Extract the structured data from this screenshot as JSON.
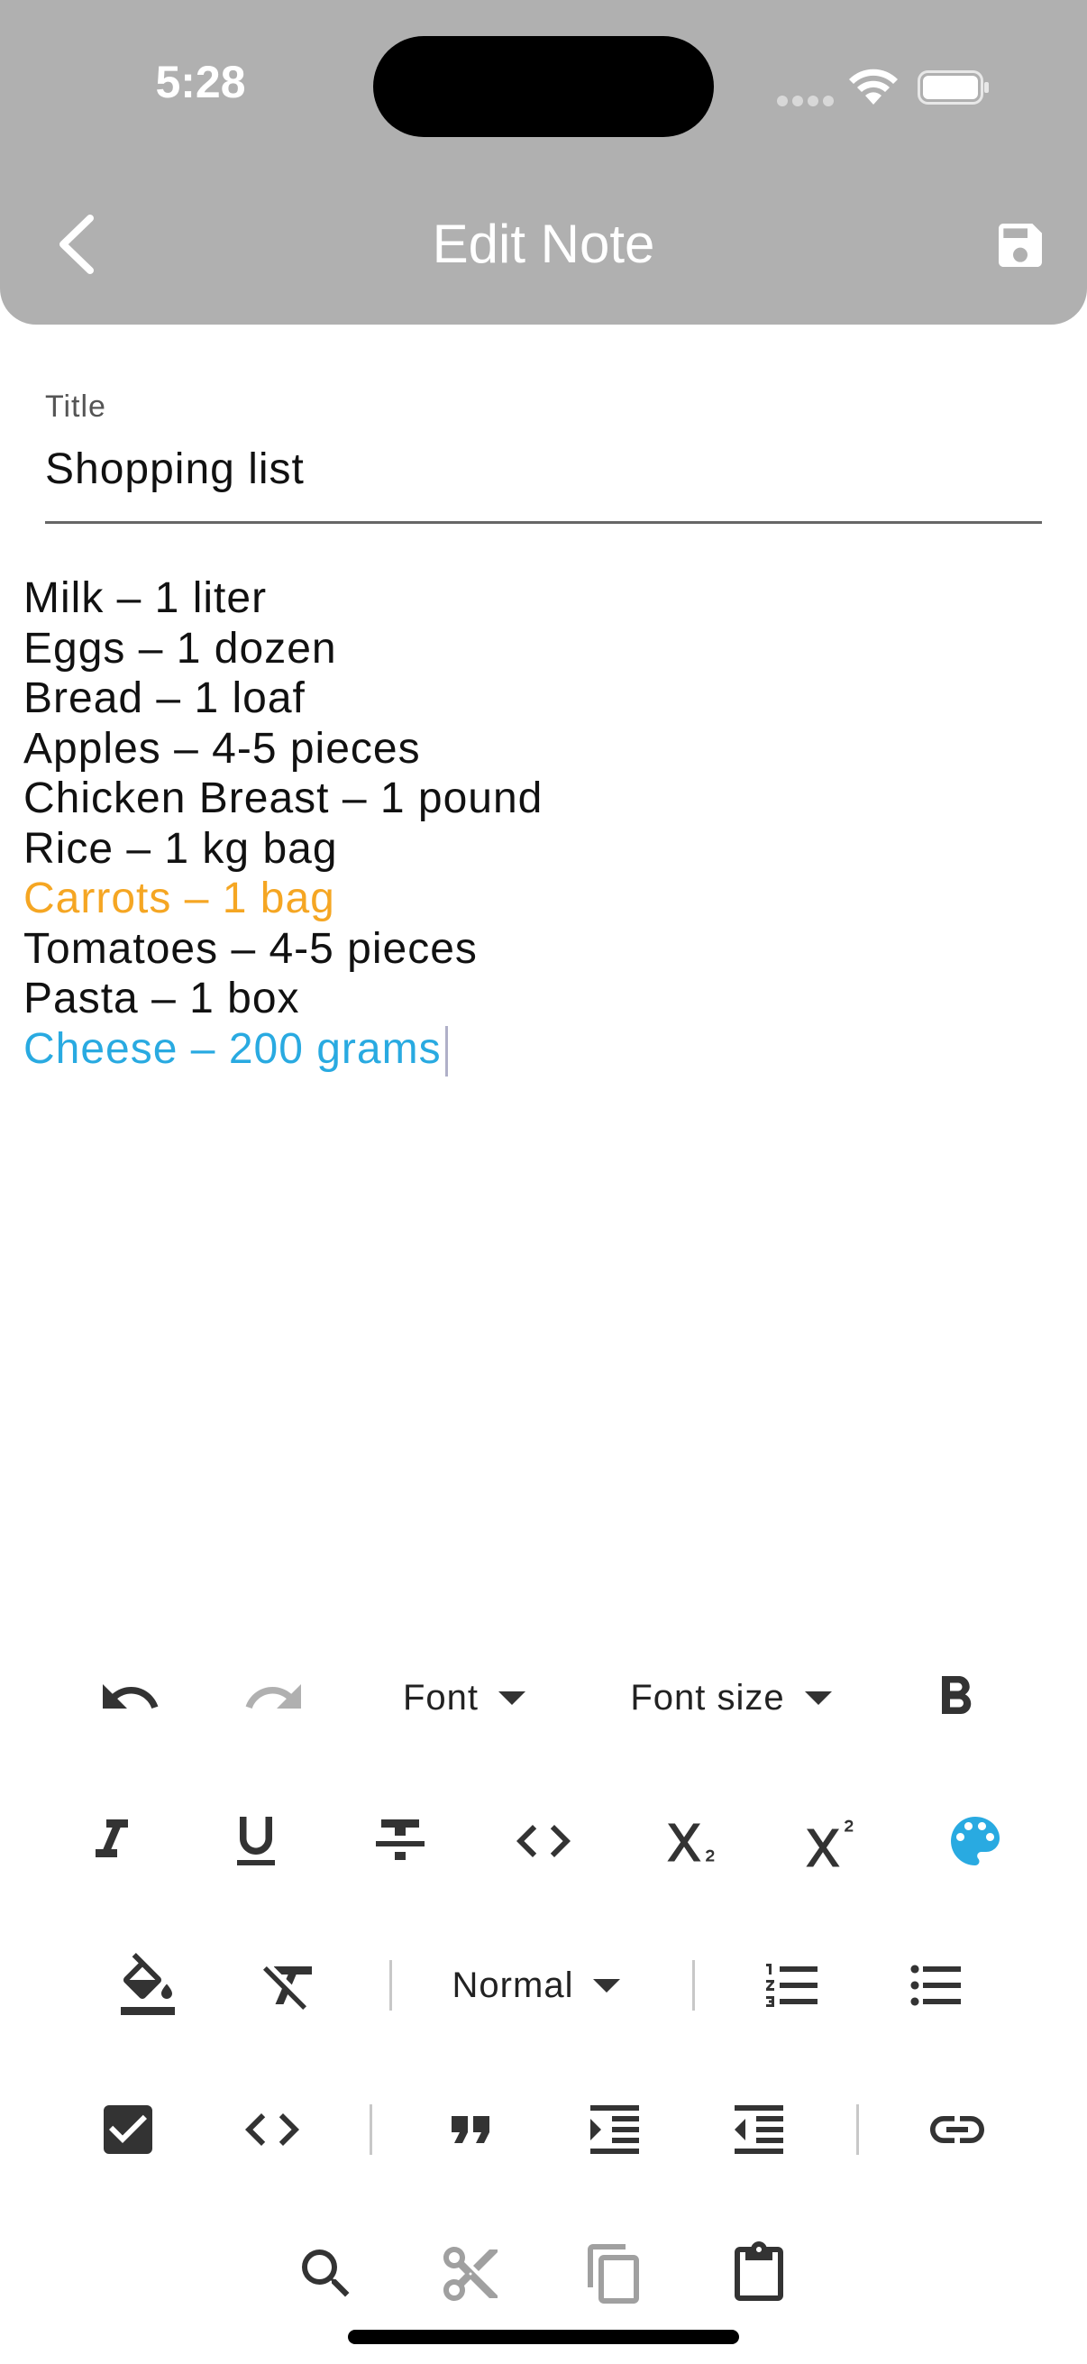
{
  "status_bar": {
    "time": "5:28"
  },
  "nav": {
    "title": "Edit Note"
  },
  "title_field": {
    "label": "Title",
    "value": "Shopping list"
  },
  "body": {
    "lines": [
      {
        "text": "Milk – 1 liter",
        "color": "#111111"
      },
      {
        "text": "Eggs – 1 dozen",
        "color": "#111111"
      },
      {
        "text": "Bread – 1 loaf",
        "color": "#111111"
      },
      {
        "text": "Apples – 4-5 pieces",
        "color": "#111111"
      },
      {
        "text": "Chicken Breast – 1 pound",
        "color": "#111111"
      },
      {
        "text": "Rice – 1 kg bag",
        "color": "#111111"
      },
      {
        "text": "Carrots – 1 bag",
        "color": "#f5a623"
      },
      {
        "text": "Tomatoes – 4-5 pieces",
        "color": "#111111"
      },
      {
        "text": "Pasta – 1 box",
        "color": "#111111"
      },
      {
        "text": "Cheese – 200 grams",
        "color": "#29aae1"
      }
    ]
  },
  "toolbar": {
    "font_label": "Font",
    "font_size_label": "Font size",
    "header_style_label": "Normal",
    "accent_color": "#29aae1",
    "icons": [
      "undo-icon",
      "redo-icon",
      "bold-icon",
      "italic-icon",
      "underline-icon",
      "strikethrough-icon",
      "inline-code-icon",
      "subscript-icon",
      "superscript-icon",
      "text-color-icon",
      "background-color-icon",
      "clear-format-icon",
      "numbered-list-icon",
      "bullet-list-icon",
      "checkbox-list-icon",
      "code-block-icon",
      "quote-icon",
      "indent-increase-icon",
      "indent-decrease-icon",
      "link-icon",
      "search-icon",
      "cut-icon",
      "copy-icon",
      "paste-icon"
    ]
  }
}
